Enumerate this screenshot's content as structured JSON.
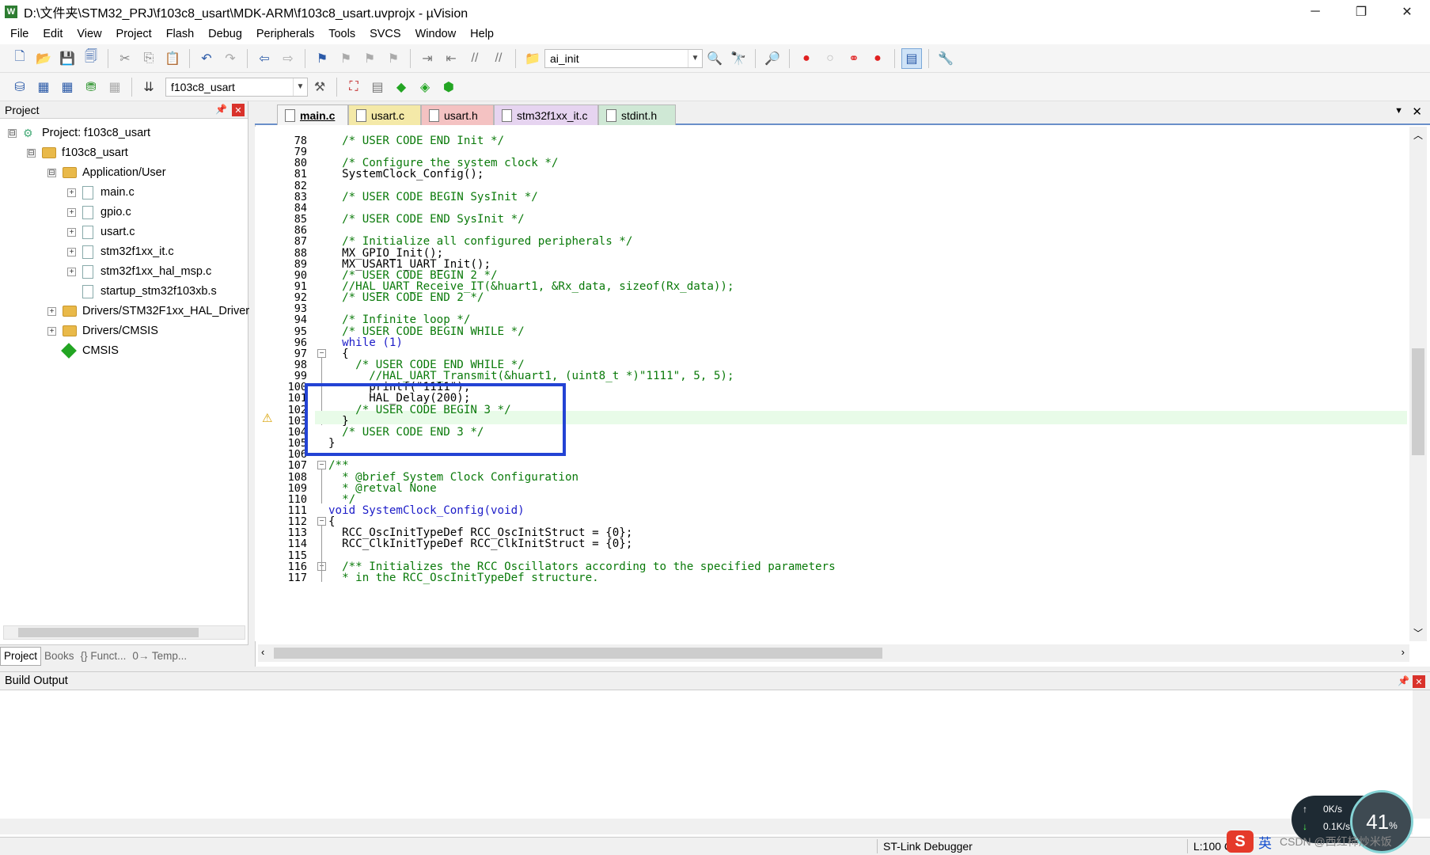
{
  "window": {
    "title": "D:\\文件夹\\STM32_PRJ\\f103c8_usart\\MDK-ARM\\f103c8_usart.uvprojx - µVision",
    "app_icon": "W",
    "controls": {
      "minimize": "─",
      "restore": "❐",
      "close": "✕"
    }
  },
  "menu": [
    "File",
    "Edit",
    "View",
    "Project",
    "Flash",
    "Debug",
    "Peripherals",
    "Tools",
    "SVCS",
    "Window",
    "Help"
  ],
  "toolbar1": {
    "find_combo": "ai_init"
  },
  "toolbar2": {
    "target_combo": "f103c8_usart"
  },
  "project_panel": {
    "title": "Project",
    "pin": "📌",
    "close": "✕",
    "tree": [
      {
        "label": "Project: f103c8_usart",
        "exp": "⊟"
      },
      {
        "label": "f103c8_usart",
        "exp": "⊟"
      },
      {
        "label": "Application/User",
        "exp": "⊟"
      },
      {
        "label": "main.c",
        "exp": "+"
      },
      {
        "label": "gpio.c",
        "exp": "+"
      },
      {
        "label": "usart.c",
        "exp": "+"
      },
      {
        "label": "stm32f1xx_it.c",
        "exp": "+"
      },
      {
        "label": "stm32f1xx_hal_msp.c",
        "exp": "+"
      },
      {
        "label": "startup_stm32f103xb.s",
        "exp": ""
      },
      {
        "label": "Drivers/STM32F1xx_HAL_Driver",
        "exp": "+"
      },
      {
        "label": "Drivers/CMSIS",
        "exp": "+"
      },
      {
        "label": "CMSIS",
        "exp": ""
      }
    ],
    "tabs": [
      "Project",
      "Books",
      "{} Funct...",
      "0→ Temp..."
    ]
  },
  "editor": {
    "tabs": [
      {
        "label": "main.c",
        "color": "#f5f5f5",
        "active": true
      },
      {
        "label": "usart.c",
        "color": "#f4e9a8"
      },
      {
        "label": "usart.h",
        "color": "#f4c2c2"
      },
      {
        "label": "stm32f1xx_it.c",
        "color": "#e6d4f0"
      },
      {
        "label": "stdint.h",
        "color": "#cfe8d5"
      }
    ],
    "lines": [
      {
        "n": "78",
        "code": "  /* USER CODE END Init */"
      },
      {
        "n": "79",
        "code": ""
      },
      {
        "n": "80",
        "code": "  /* Configure the system clock */"
      },
      {
        "n": "81",
        "code": "  SystemClock_Config();"
      },
      {
        "n": "82",
        "code": ""
      },
      {
        "n": "83",
        "code": "  /* USER CODE BEGIN SysInit */"
      },
      {
        "n": "84",
        "code": ""
      },
      {
        "n": "85",
        "code": "  /* USER CODE END SysInit */"
      },
      {
        "n": "86",
        "code": ""
      },
      {
        "n": "87",
        "code": "  /* Initialize all configured peripherals */"
      },
      {
        "n": "88",
        "code": "  MX_GPIO_Init();"
      },
      {
        "n": "89",
        "code": "  MX_USART1_UART_Init();"
      },
      {
        "n": "90",
        "code": "  /* USER CODE BEGIN 2 */"
      },
      {
        "n": "91",
        "code": "  //HAL_UART_Receive_IT(&huart1, &Rx_data, sizeof(Rx_data));"
      },
      {
        "n": "92",
        "code": "  /* USER CODE END 2 */"
      },
      {
        "n": "93",
        "code": ""
      },
      {
        "n": "94",
        "code": "  /* Infinite loop */"
      },
      {
        "n": "95",
        "code": "  /* USER CODE BEGIN WHILE */"
      },
      {
        "n": "96",
        "code": "  while (1)"
      },
      {
        "n": "97",
        "code": "  {"
      },
      {
        "n": "98",
        "code": "    /* USER CODE END WHILE */"
      },
      {
        "n": "99",
        "code": "      //HAL_UART_Transmit(&huart1, (uint8_t *)\"1111\", 5, 5);"
      },
      {
        "n": "100",
        "code": "      printf(\"1111\");"
      },
      {
        "n": "101",
        "code": "      HAL_Delay(200);"
      },
      {
        "n": "102",
        "code": "    /* USER CODE BEGIN 3 */"
      },
      {
        "n": "103",
        "code": "  }"
      },
      {
        "n": "104",
        "code": "  /* USER CODE END 3 */"
      },
      {
        "n": "105",
        "code": "}"
      },
      {
        "n": "106",
        "code": ""
      },
      {
        "n": "107",
        "code": "/**"
      },
      {
        "n": "108",
        "code": "  * @brief System Clock Configuration"
      },
      {
        "n": "109",
        "code": "  * @retval None"
      },
      {
        "n": "110",
        "code": "  */"
      },
      {
        "n": "111",
        "code": "void SystemClock_Config(void)"
      },
      {
        "n": "112",
        "code": "{"
      },
      {
        "n": "113",
        "code": "  RCC_OscInitTypeDef RCC_OscInitStruct = {0};"
      },
      {
        "n": "114",
        "code": "  RCC_ClkInitTypeDef RCC_ClkInitStruct = {0};"
      },
      {
        "n": "115",
        "code": ""
      },
      {
        "n": "116",
        "code": "  /** Initializes the RCC Oscillators according to the specified parameters"
      },
      {
        "n": "117",
        "code": "  * in the RCC_OscInitTypeDef structure."
      }
    ],
    "warning_line": "100"
  },
  "build_output": {
    "title": "Build Output",
    "text": ""
  },
  "status": {
    "debugger": "ST-Link Debugger",
    "position": "L:100 C"
  },
  "overlay": {
    "net_up": "0K/s",
    "net_down": "0.1K/s",
    "cpu": "41",
    "cpu_unit": "%",
    "ime_label": "英",
    "watermark": "CSDN @西红柿炒米饭"
  }
}
